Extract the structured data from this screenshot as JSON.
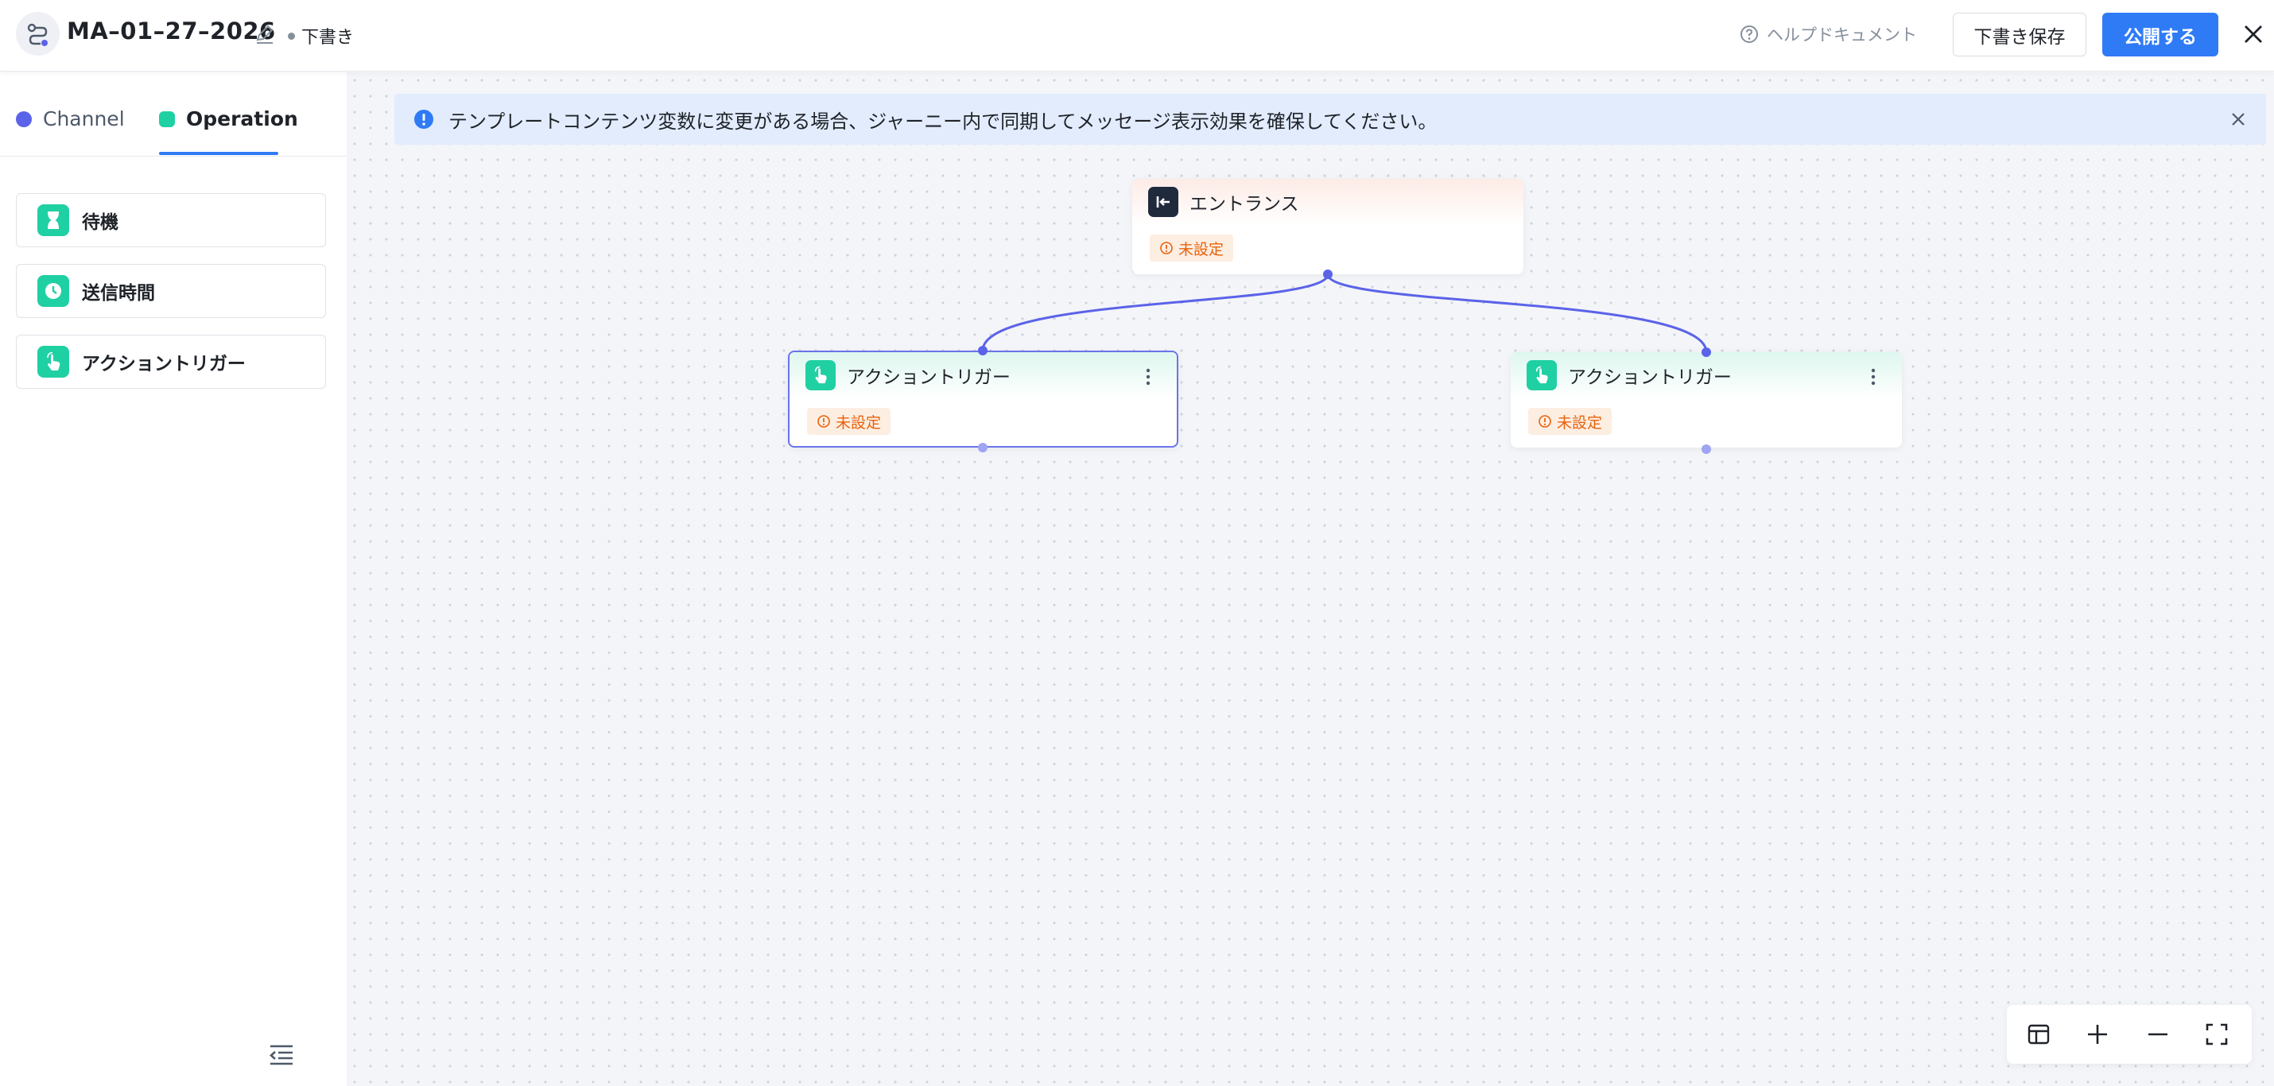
{
  "header": {
    "title": "MA–01–27–2026",
    "status": "下書き",
    "help_label": "ヘルプドキュメント",
    "save_draft_label": "下書き保存",
    "publish_label": "公開する"
  },
  "sidebar": {
    "tabs": [
      {
        "label": "Channel",
        "active": false
      },
      {
        "label": "Operation",
        "active": true
      }
    ],
    "operations": [
      {
        "label": "待機",
        "icon": "hourglass-icon"
      },
      {
        "label": "送信時間",
        "icon": "clock-icon"
      },
      {
        "label": "アクショントリガー",
        "icon": "tap-hand-icon"
      }
    ]
  },
  "canvas": {
    "banner_text": "テンプレートコンテンツ変数に変更がある場合、ジャーニー内で同期してメッセージ表示効果を確保してください。",
    "nodes": [
      {
        "title": "エントランス",
        "status": "未設定",
        "icon": "entry-icon"
      },
      {
        "title": "アクショントリガー",
        "status": "未設定",
        "icon": "tap-hand-icon",
        "selected": true
      },
      {
        "title": "アクショントリガー",
        "status": "未設定",
        "icon": "tap-hand-icon",
        "selected": false
      }
    ]
  },
  "colors": {
    "accent": "#2f7bf5",
    "channel": "#5b63e8",
    "operation": "#1fd0a3",
    "warning": "#e8620c",
    "edge": "#5b63e8"
  }
}
